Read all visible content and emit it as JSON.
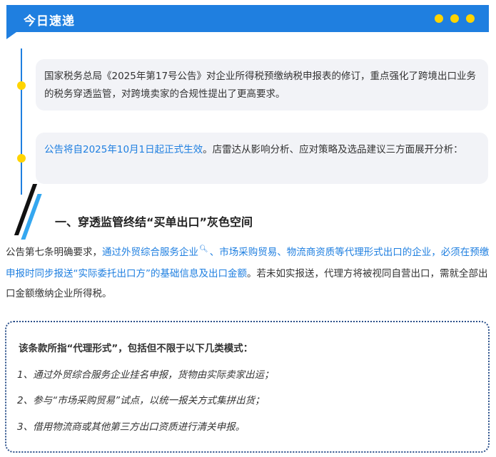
{
  "header": {
    "title": "今日速递",
    "accent_color": "#1f7fe0",
    "dot_color": "#ffd400"
  },
  "cards": [
    {
      "text": "国家税务总局《2025年第17号公告》对企业所得税预缴纳税申报表的修订，重点强化了跨境出口业务的税务穿透监管，对跨境卖家的合规性提出了更高要求。"
    },
    {
      "highlight": "公告将自2025年10月1日起正式生效",
      "text": "。店雷达从影响分析、应对策略及选品建议三方面展开分析："
    }
  ],
  "section": {
    "title": "一、穿透监管终结“买单出口”灰色空间"
  },
  "paragraph": {
    "part1": "公告第七条明确要求，",
    "link1": "通过外贸综合服务企业",
    "search_icon": "search-icon",
    "link2": "、市场采购贸易、物流商资质等代理形式出口的企业，必须在预缴申报时同步报送“实际委托出口方”的基础信息及出口金额",
    "part2": "。若未如实报送，代理方将被视同自营出口，需就全部出口金额缴纳企业所得税。"
  },
  "box": {
    "heading": "该条款所指“代理形式”，包括但不限于以下几类模式：",
    "items": [
      "1、通过外贸综合服务企业挂名申报，货物由实际卖家出运；",
      "2、参与“市场采购贸易”试点，以统一报关方式集拼出货；",
      "3、借用物流商或其他第三方出口资质进行清关申报。"
    ]
  }
}
